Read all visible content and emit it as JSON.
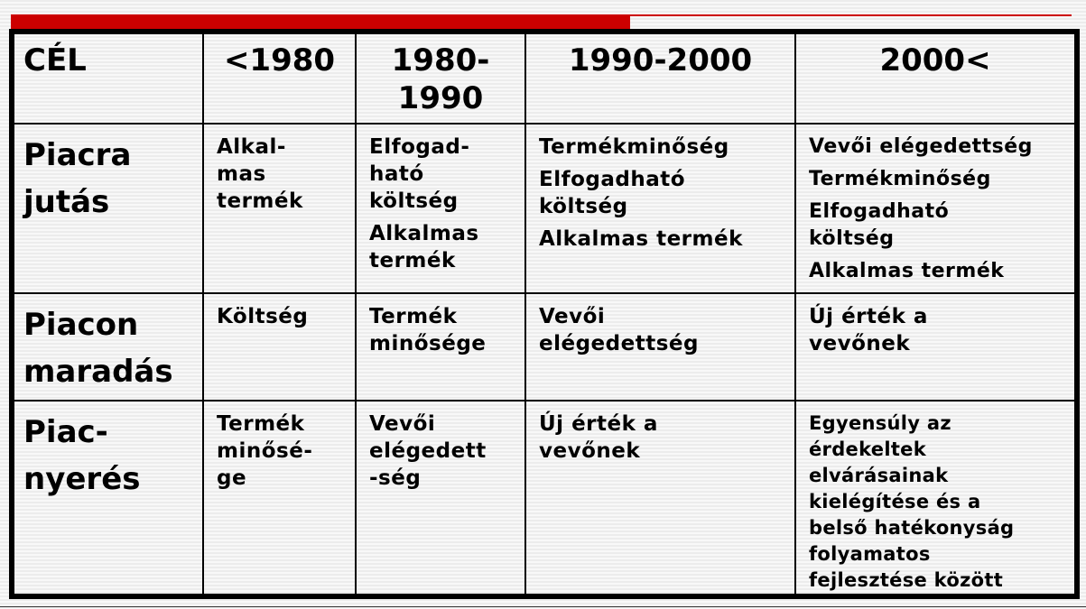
{
  "decorations": {
    "accent_color": "#cc0000",
    "border_color": "#000000"
  },
  "table": {
    "headers": [
      "CÉL",
      "<1980",
      "1980-\n1990",
      "1990-2000",
      "2000<"
    ],
    "rows": [
      {
        "label": "Piacra\njutás",
        "cells": [
          [
            "Alkal-\nmas\ntermék"
          ],
          [
            "Elfogad-\nható\nköltség",
            "Alkalmas\ntermék"
          ],
          [
            "Termékminőség",
            "Elfogadható\nköltség",
            "Alkalmas termék"
          ],
          [
            "Vevői elégedettség",
            "Termékminőség",
            "Elfogadható\nköltség",
            "Alkalmas termék"
          ]
        ]
      },
      {
        "label": "Piacon\nmaradás",
        "cells": [
          [
            "Költség"
          ],
          [
            "Termék\nminősége"
          ],
          [
            "Vevői\nelégedettség"
          ],
          [
            "Új érték a\nvevőnek"
          ]
        ]
      },
      {
        "label": "Piac-\nnyerés",
        "cells": [
          [
            "Termék\nminősé-\nge"
          ],
          [
            "Vevői\nelégedett\n-ség"
          ],
          [
            "Új érték a\nvevőnek"
          ],
          [
            "Egyensúly az\nérdekeltek\nelvárásainak\nkielégítése és a\nbelső hatékonyság\nfolyamatos\nfejlesztése között"
          ]
        ]
      }
    ]
  }
}
